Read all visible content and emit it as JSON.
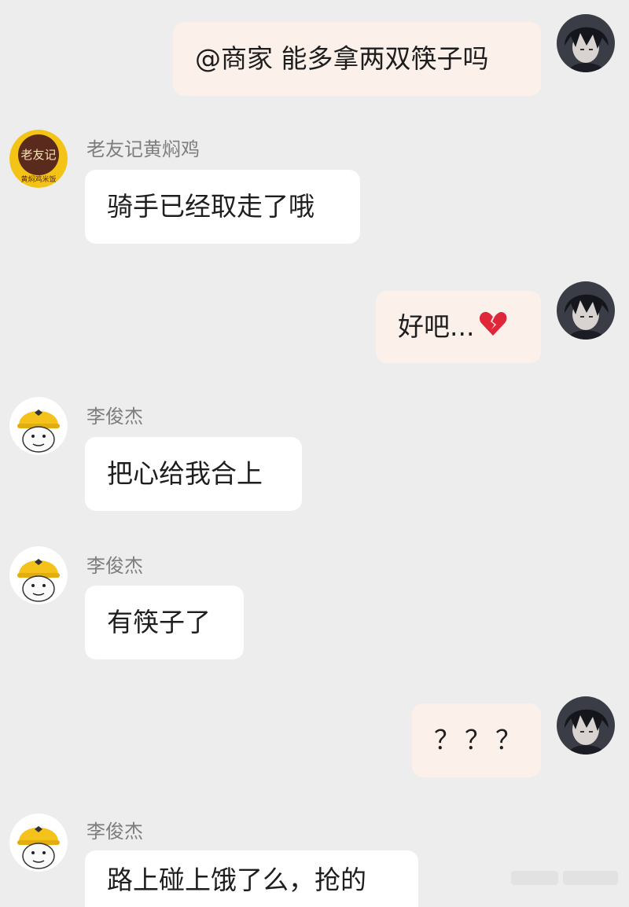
{
  "messages": [
    {
      "side": "out",
      "text": "@商家 能多拿两双筷子吗"
    },
    {
      "side": "in",
      "sender": "老友记黄焖鸡",
      "avatar_type": "shop",
      "text": "骑手已经取走了哦"
    },
    {
      "side": "out",
      "text": "好吧...",
      "emoji": "broken-heart-icon"
    },
    {
      "side": "in",
      "sender": "李俊杰",
      "avatar_type": "rider",
      "text": "把心给我合上"
    },
    {
      "side": "in",
      "sender": "李俊杰",
      "avatar_type": "rider",
      "text": "有筷子了"
    },
    {
      "side": "out",
      "text": "？？？"
    },
    {
      "side": "in",
      "sender": "李俊杰",
      "avatar_type": "rider",
      "text": "路上碰上饿了么，抢的"
    }
  ],
  "shop_avatar": {
    "line1": "老友记",
    "line2": "黄焖鸡米饭"
  },
  "colors": {
    "background": "#ededed",
    "outgoing_bubble": "#fbf0ea",
    "incoming_bubble": "#ffffff",
    "sender_name": "#7d7d7d",
    "shop_avatar_yellow": "#f3c316",
    "shop_avatar_brown": "#5a2a1c",
    "rider_avatar_yellow": "#f4c21a"
  }
}
